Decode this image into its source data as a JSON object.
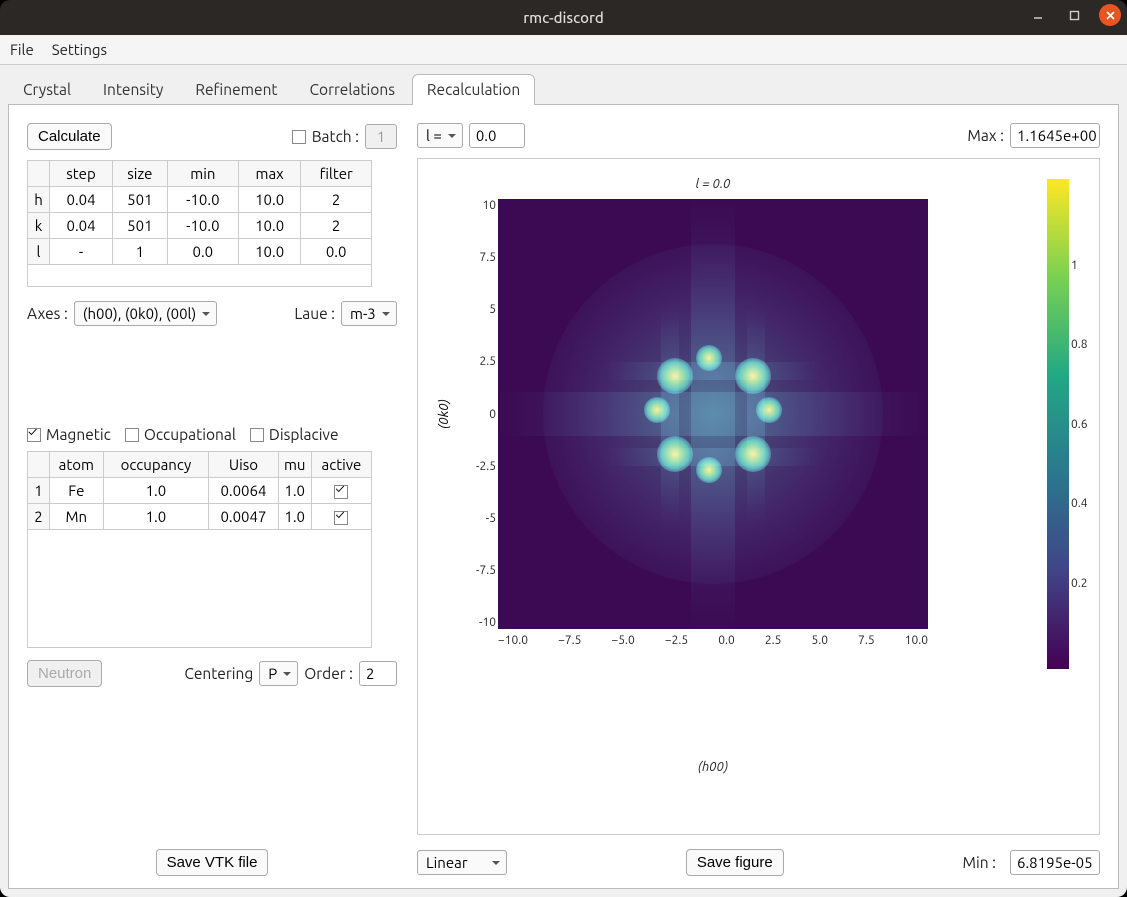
{
  "window": {
    "title": "rmc-discord"
  },
  "menu": {
    "items": [
      "File",
      "Settings"
    ]
  },
  "tabs": {
    "items": [
      "Crystal",
      "Intensity",
      "Refinement",
      "Correlations",
      "Recalculation"
    ],
    "active_index": 4
  },
  "left_panel": {
    "calculate_label": "Calculate",
    "batch_label": "Batch :",
    "batch_value": "1",
    "grid_headers": [
      "step",
      "size",
      "min",
      "max",
      "filter"
    ],
    "grid_row_labels": [
      "h",
      "k",
      "l"
    ],
    "grid_rows": [
      [
        "0.04",
        "501",
        "-10.0",
        "10.0",
        "2"
      ],
      [
        "0.04",
        "501",
        "-10.0",
        "10.0",
        "2"
      ],
      [
        "-",
        "1",
        "0.0",
        "10.0",
        "0.0"
      ]
    ],
    "axes_label": "Axes :",
    "axes_value": "(h00), (0k0), (00l)",
    "laue_label": "Laue :",
    "laue_value": "m-3",
    "magnetic_label": "Magnetic",
    "occupational_label": "Occupational",
    "displacive_label": "Displacive",
    "atom_headers": [
      "atom",
      "occupancy",
      "Uiso",
      "mu",
      "active"
    ],
    "atom_row_labels": [
      "1",
      "2"
    ],
    "atom_rows": [
      [
        "Fe",
        "1.0",
        "0.0064",
        "1.0",
        true
      ],
      [
        "Mn",
        "1.0",
        "0.0047",
        "1.0",
        true
      ]
    ],
    "neutron_label": "Neutron",
    "centering_label": "Centering",
    "centering_value": "P",
    "order_label": "Order :",
    "order_value": "2",
    "save_vtk_label": "Save VTK file"
  },
  "right_panel": {
    "slice_axis_value": "l =",
    "slice_value": "0.0",
    "max_label": "Max :",
    "max_value": "1.1645e+00",
    "scale_value": "Linear",
    "save_figure_label": "Save figure",
    "min_label": "Min :",
    "min_value": "6.8195e-05"
  },
  "chart_data": {
    "type": "heatmap",
    "title": "l = 0.0",
    "xlabel": "(h00)",
    "ylabel": "(0k0)",
    "x_range": [
      -10.0,
      10.0
    ],
    "y_range": [
      -10.0,
      10.0
    ],
    "x_ticks": [
      -10.0,
      -7.5,
      -5.0,
      -2.5,
      0.0,
      2.5,
      5.0,
      7.5,
      10.0
    ],
    "y_ticks": [
      -10.0,
      -7.5,
      -5.0,
      -2.5,
      0.0,
      2.5,
      5.0,
      7.5,
      10.0
    ],
    "colorbar_ticks": [
      0.2,
      0.4,
      0.6,
      0.8,
      1.0
    ],
    "colormap": "viridis",
    "value_range": [
      6.8195e-05,
      1.1645
    ],
    "description": "Magnetic diffuse scattering intensity map in the (h,k,0) plane. Four-fold symmetric diffuse square of high intensity centered on origin with corners near (±2.5, ±2.5); weaker diffuse streaks along h and k axes extending past ±7; broad low-level background filling the plane."
  }
}
